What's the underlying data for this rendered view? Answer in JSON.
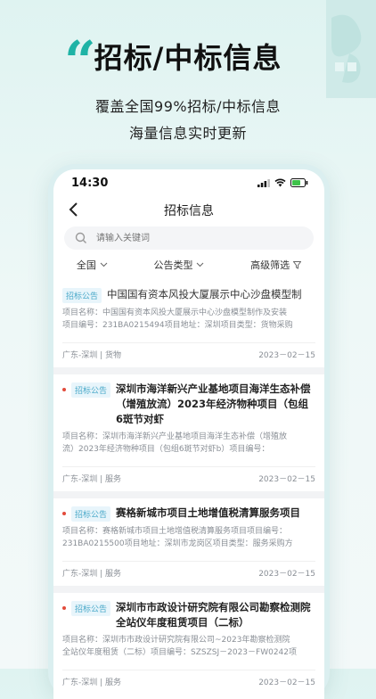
{
  "hero": {
    "quote_mark": "“",
    "title": "招标/中标信息",
    "subtitle_line1": "覆盖全国99%招标/中标信息",
    "subtitle_line2": "海量信息实时更新"
  },
  "status_bar": {
    "time": "14:30"
  },
  "navbar": {
    "title": "招标信息"
  },
  "search": {
    "placeholder": "请输入关键词"
  },
  "filters": [
    {
      "label": "全国",
      "icon": "chevron-down-icon"
    },
    {
      "label": "公告类型",
      "icon": "chevron-down-icon"
    },
    {
      "label": "高级筛选",
      "icon": "filter-icon"
    }
  ],
  "cards": [
    {
      "tag": "招标公告",
      "unread": false,
      "title": "中国国有资本风投大厦展示中心沙盘模型制",
      "meta1": "项目名称：中国国有资本风投大厦展示中心沙盘模型制作及安装",
      "meta2": "项目编号：231BA0215494项目地址：深圳项目类型：货物采购",
      "location": "广东-深圳 | 货物",
      "date": "2023－02－15"
    },
    {
      "tag": "招标公告",
      "unread": true,
      "title": "深圳市海洋新兴产业基地项目海洋生态补偿（增殖放流）2023年经济物种项目（包组6斑节对虾",
      "meta1": "项目名称：深圳市海洋新兴产业基地项目海洋生态补偿（增殖放",
      "meta2": "流）2023年经济物种项目（包组6斑节对虾b）项目编号：",
      "location": "广东-深圳 | 服务",
      "date": "2023－02－15"
    },
    {
      "tag": "招标公告",
      "unread": true,
      "title": "赛格新城市项目土地增值税清算服务项目",
      "meta1": "项目名称：赛格新城市项目土地增值税清算服务项目项目编号：",
      "meta2": "231BA0215500项目地址：深圳市龙岗区项目类型：服务采购方",
      "location": "广东-深圳 | 服务",
      "date": "2023－02－15"
    },
    {
      "tag": "招标公告",
      "unread": true,
      "title": "深圳市市政设计研究院有限公司勘察检测院全站仪年度租赁项目（二标）",
      "meta1": "项目名称：深圳市市政设计研究院有限公司~2023年勘察检测院",
      "meta2": "全站仪年度租赁（二标）项目编号：SZSZSJ－2023－FW0242项",
      "location": "广东-深圳 | 服务",
      "date": "2023－02－15"
    }
  ],
  "colors": {
    "accent": "#1fb3a6",
    "tag_text": "#4aa9c9",
    "unread_dot": "#e24b3b"
  }
}
